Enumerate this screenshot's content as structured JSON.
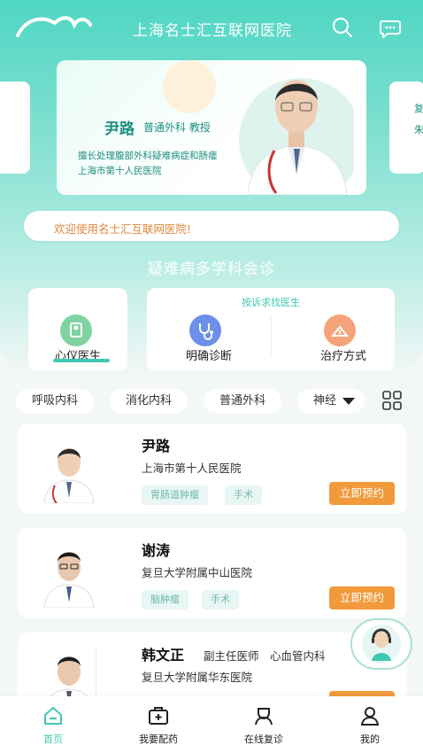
{
  "app": {
    "title": "上海名士汇互联网医院"
  },
  "banner": {
    "doctor_name": "尹路",
    "doctor_title": "普通外科 教授",
    "desc_line1": "擅长处理腹部外科疑难病症和肠瘘",
    "desc_line2": "上海市第十人民医院",
    "right_peek_line1": "复",
    "right_peek_line2": "朱"
  },
  "welcome": {
    "text": "欢迎使用名士汇互联网医院!"
  },
  "consult": {
    "title": "疑难病多学科会诊",
    "left_label": "心仪医生",
    "right_subtitle": "按诉求找医生",
    "middle_label": "明确诊断",
    "right_label": "治疗方式"
  },
  "departments": [
    "呼吸内科",
    "消化内科",
    "普通外科",
    "神经"
  ],
  "doctors": [
    {
      "name": "尹路",
      "title": "",
      "hospital": "上海市第十人民医院",
      "tags": [
        "胃肠道肿瘤",
        "手术"
      ],
      "button": "立即预约"
    },
    {
      "name": "谢涛",
      "title": "",
      "hospital": "复旦大学附属中山医院",
      "tags": [
        "脑肿瘤",
        "手术"
      ],
      "button": "立即预约"
    },
    {
      "name": "韩文正",
      "title": "副主任医师　心血管内科",
      "hospital": "复旦大学附属华东医院",
      "tags": [],
      "button": "立即预约"
    }
  ],
  "tabbar": [
    {
      "label": "首页",
      "icon": "home-icon",
      "active": true
    },
    {
      "label": "我要配药",
      "icon": "medicine-box-icon",
      "active": false
    },
    {
      "label": "在线复诊",
      "icon": "doctor-icon",
      "active": false
    },
    {
      "label": "我的",
      "icon": "user-icon",
      "active": false
    }
  ],
  "colors": {
    "accent": "#3ec9b3",
    "orange": "#f09a3b",
    "active_tab": "#3ec9b3"
  }
}
